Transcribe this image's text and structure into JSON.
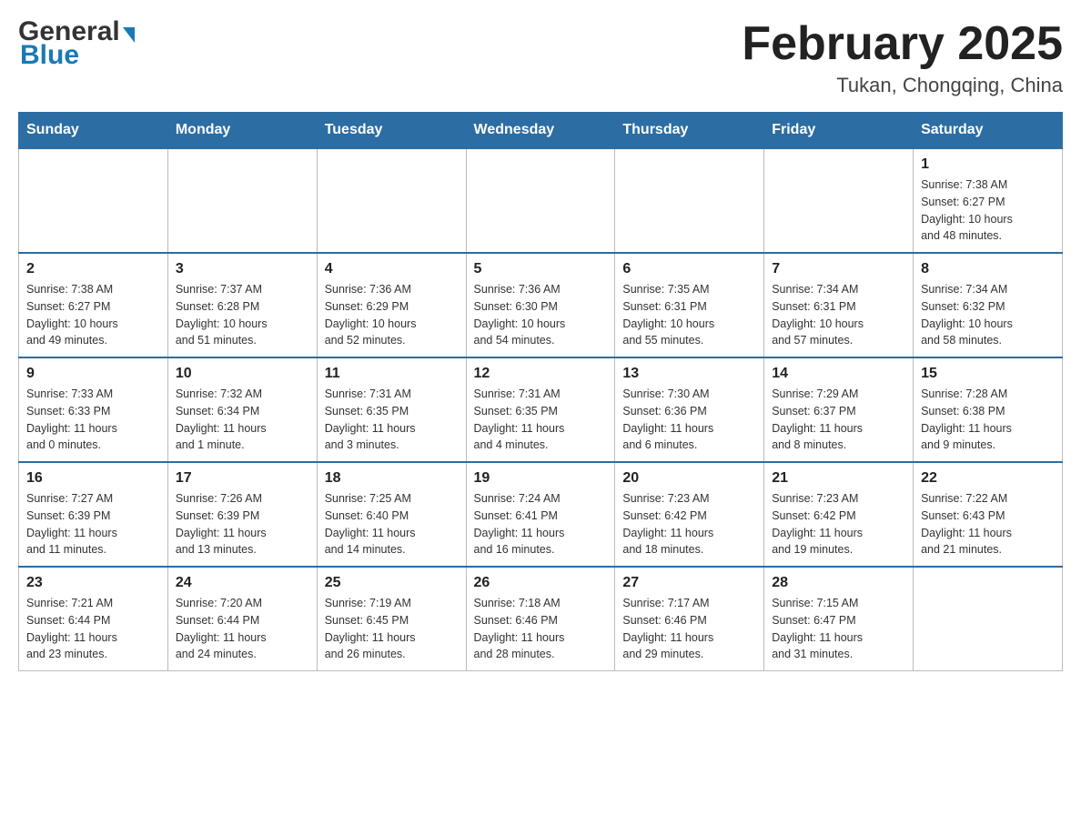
{
  "header": {
    "logo_general": "General",
    "logo_blue": "Blue",
    "main_title": "February 2025",
    "subtitle": "Tukan, Chongqing, China"
  },
  "calendar": {
    "days_of_week": [
      "Sunday",
      "Monday",
      "Tuesday",
      "Wednesday",
      "Thursday",
      "Friday",
      "Saturday"
    ],
    "weeks": [
      [
        {
          "day": "",
          "info": ""
        },
        {
          "day": "",
          "info": ""
        },
        {
          "day": "",
          "info": ""
        },
        {
          "day": "",
          "info": ""
        },
        {
          "day": "",
          "info": ""
        },
        {
          "day": "",
          "info": ""
        },
        {
          "day": "1",
          "info": "Sunrise: 7:38 AM\nSunset: 6:27 PM\nDaylight: 10 hours\nand 48 minutes."
        }
      ],
      [
        {
          "day": "2",
          "info": "Sunrise: 7:38 AM\nSunset: 6:27 PM\nDaylight: 10 hours\nand 49 minutes."
        },
        {
          "day": "3",
          "info": "Sunrise: 7:37 AM\nSunset: 6:28 PM\nDaylight: 10 hours\nand 51 minutes."
        },
        {
          "day": "4",
          "info": "Sunrise: 7:36 AM\nSunset: 6:29 PM\nDaylight: 10 hours\nand 52 minutes."
        },
        {
          "day": "5",
          "info": "Sunrise: 7:36 AM\nSunset: 6:30 PM\nDaylight: 10 hours\nand 54 minutes."
        },
        {
          "day": "6",
          "info": "Sunrise: 7:35 AM\nSunset: 6:31 PM\nDaylight: 10 hours\nand 55 minutes."
        },
        {
          "day": "7",
          "info": "Sunrise: 7:34 AM\nSunset: 6:31 PM\nDaylight: 10 hours\nand 57 minutes."
        },
        {
          "day": "8",
          "info": "Sunrise: 7:34 AM\nSunset: 6:32 PM\nDaylight: 10 hours\nand 58 minutes."
        }
      ],
      [
        {
          "day": "9",
          "info": "Sunrise: 7:33 AM\nSunset: 6:33 PM\nDaylight: 11 hours\nand 0 minutes."
        },
        {
          "day": "10",
          "info": "Sunrise: 7:32 AM\nSunset: 6:34 PM\nDaylight: 11 hours\nand 1 minute."
        },
        {
          "day": "11",
          "info": "Sunrise: 7:31 AM\nSunset: 6:35 PM\nDaylight: 11 hours\nand 3 minutes."
        },
        {
          "day": "12",
          "info": "Sunrise: 7:31 AM\nSunset: 6:35 PM\nDaylight: 11 hours\nand 4 minutes."
        },
        {
          "day": "13",
          "info": "Sunrise: 7:30 AM\nSunset: 6:36 PM\nDaylight: 11 hours\nand 6 minutes."
        },
        {
          "day": "14",
          "info": "Sunrise: 7:29 AM\nSunset: 6:37 PM\nDaylight: 11 hours\nand 8 minutes."
        },
        {
          "day": "15",
          "info": "Sunrise: 7:28 AM\nSunset: 6:38 PM\nDaylight: 11 hours\nand 9 minutes."
        }
      ],
      [
        {
          "day": "16",
          "info": "Sunrise: 7:27 AM\nSunset: 6:39 PM\nDaylight: 11 hours\nand 11 minutes."
        },
        {
          "day": "17",
          "info": "Sunrise: 7:26 AM\nSunset: 6:39 PM\nDaylight: 11 hours\nand 13 minutes."
        },
        {
          "day": "18",
          "info": "Sunrise: 7:25 AM\nSunset: 6:40 PM\nDaylight: 11 hours\nand 14 minutes."
        },
        {
          "day": "19",
          "info": "Sunrise: 7:24 AM\nSunset: 6:41 PM\nDaylight: 11 hours\nand 16 minutes."
        },
        {
          "day": "20",
          "info": "Sunrise: 7:23 AM\nSunset: 6:42 PM\nDaylight: 11 hours\nand 18 minutes."
        },
        {
          "day": "21",
          "info": "Sunrise: 7:23 AM\nSunset: 6:42 PM\nDaylight: 11 hours\nand 19 minutes."
        },
        {
          "day": "22",
          "info": "Sunrise: 7:22 AM\nSunset: 6:43 PM\nDaylight: 11 hours\nand 21 minutes."
        }
      ],
      [
        {
          "day": "23",
          "info": "Sunrise: 7:21 AM\nSunset: 6:44 PM\nDaylight: 11 hours\nand 23 minutes."
        },
        {
          "day": "24",
          "info": "Sunrise: 7:20 AM\nSunset: 6:44 PM\nDaylight: 11 hours\nand 24 minutes."
        },
        {
          "day": "25",
          "info": "Sunrise: 7:19 AM\nSunset: 6:45 PM\nDaylight: 11 hours\nand 26 minutes."
        },
        {
          "day": "26",
          "info": "Sunrise: 7:18 AM\nSunset: 6:46 PM\nDaylight: 11 hours\nand 28 minutes."
        },
        {
          "day": "27",
          "info": "Sunrise: 7:17 AM\nSunset: 6:46 PM\nDaylight: 11 hours\nand 29 minutes."
        },
        {
          "day": "28",
          "info": "Sunrise: 7:15 AM\nSunset: 6:47 PM\nDaylight: 11 hours\nand 31 minutes."
        },
        {
          "day": "",
          "info": ""
        }
      ]
    ]
  }
}
